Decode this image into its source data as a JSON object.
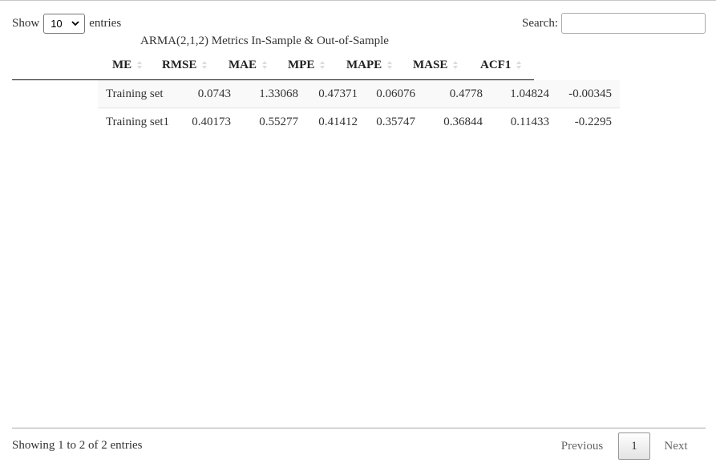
{
  "length_menu": {
    "show_label": "Show",
    "selected": "10",
    "entries_label": "entries"
  },
  "search": {
    "label": "Search:",
    "value": ""
  },
  "caption": "ARMA(2,1,2) Metrics In-Sample & Out-of-Sample",
  "columns": [
    "ME",
    "RMSE",
    "MAE",
    "MPE",
    "MAPE",
    "MASE",
    "ACF1"
  ],
  "rows": [
    {
      "name": "Training set",
      "values": [
        "0.0743",
        "1.33068",
        "0.47371",
        "0.06076",
        "0.4778",
        "1.04824",
        "-0.00345"
      ]
    },
    {
      "name": "Training set1",
      "values": [
        "0.40173",
        "0.55277",
        "0.41412",
        "0.35747",
        "0.36844",
        "0.11433",
        "-0.2295"
      ]
    }
  ],
  "info": "Showing 1 to 2 of 2 entries",
  "pagination": {
    "previous": "Previous",
    "current": "1",
    "next": "Next"
  },
  "icons": {
    "select_arrow": "chevron-down-icon",
    "sort": "sort-both-icon"
  }
}
